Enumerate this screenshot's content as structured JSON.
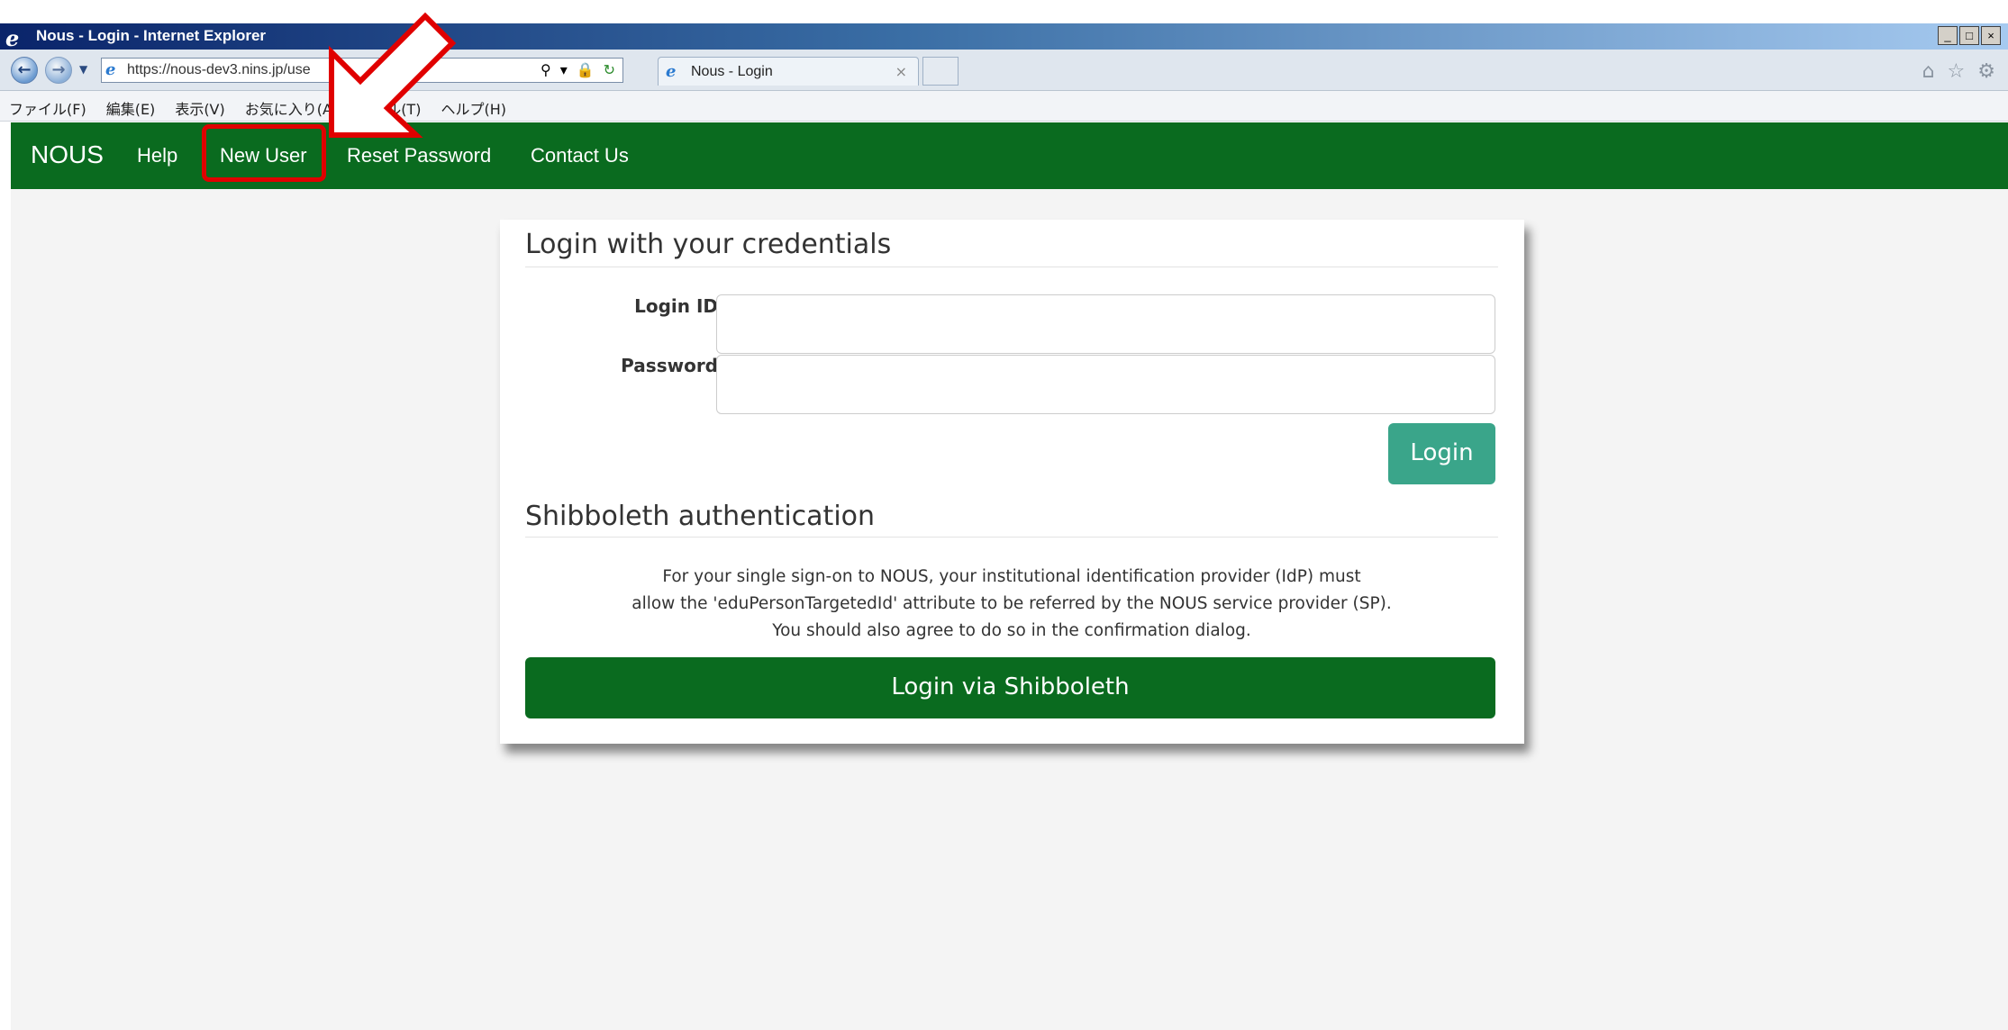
{
  "browser": {
    "logo_glyph": "e",
    "window_title": "Nous - Login - Internet Explorer",
    "url": "https://nous-dev3.nins.jp/use",
    "tab_title": "Nous - Login",
    "tab_close": "×",
    "window_controls": [
      "_",
      "□",
      "×"
    ],
    "menu": [
      "ファイル(F)",
      "編集(E)",
      "表示(V)",
      "お気に入り(A)",
      "ツール(T)",
      "ヘルプ(H)"
    ],
    "toolbar_icons": [
      "⌂",
      "☆",
      "⚙"
    ]
  },
  "nav": {
    "brand": "NOUS",
    "links": [
      "Help",
      "New User",
      "Reset Password",
      "Contact Us"
    ]
  },
  "login": {
    "title": "Login with your credentials",
    "login_id_label": "Login ID:",
    "password_label": "Password:",
    "login_id_value": "",
    "password_value": "",
    "login_button": "Login"
  },
  "shibboleth": {
    "title": "Shibboleth authentication",
    "line1": "For your single sign-on to NOUS, your institutional identification provider (IdP) must",
    "line2": "allow the 'eduPersonTargetedId' attribute to be referred by the NOUS service provider (SP).",
    "line3": "You should also agree to do so in the confirmation dialog.",
    "button": "Login via Shibboleth"
  },
  "colors": {
    "nav_green": "#0a6b1f",
    "login_teal": "#3aa58a",
    "highlight_red": "#e00000"
  }
}
